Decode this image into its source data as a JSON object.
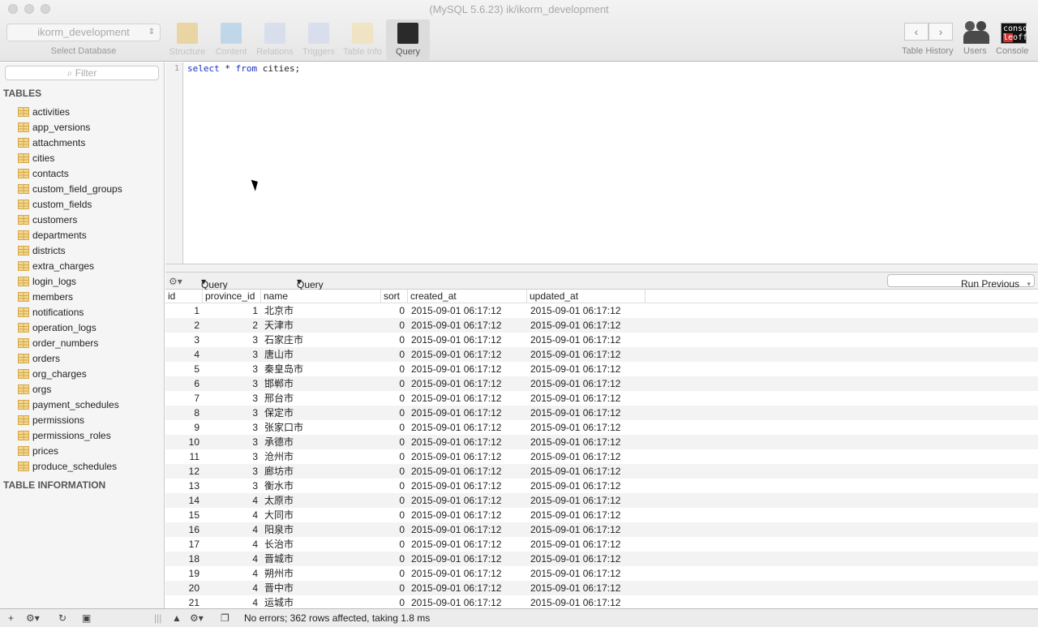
{
  "window": {
    "title": "(MySQL 5.6.23) ik/ikorm_development"
  },
  "toolbar": {
    "database": "ikorm_development",
    "select_database": "Select Database",
    "tabs": [
      {
        "label": "Structure",
        "color": "#e8c36a"
      },
      {
        "label": "Content",
        "color": "#9cc4e8"
      },
      {
        "label": "Relations",
        "color": "#c8d4ec"
      },
      {
        "label": "Triggers",
        "color": "#c8d4ec"
      },
      {
        "label": "Table Info",
        "color": "#f0dca0"
      },
      {
        "label": "Query",
        "color": "#2a2a2a"
      }
    ],
    "table_history": "Table History",
    "users": "Users",
    "console": "Console",
    "console_icon_text": "conso le off"
  },
  "sidebar": {
    "filter_placeholder": "Filter",
    "tables_heading": "TABLES",
    "table_info_heading": "TABLE INFORMATION",
    "tables": [
      "activities",
      "app_versions",
      "attachments",
      "cities",
      "contacts",
      "custom_field_groups",
      "custom_fields",
      "customers",
      "departments",
      "districts",
      "extra_charges",
      "login_logs",
      "members",
      "notifications",
      "operation_logs",
      "order_numbers",
      "orders",
      "org_charges",
      "orgs",
      "payment_schedules",
      "permissions",
      "permissions_roles",
      "prices",
      "produce_schedules"
    ]
  },
  "editor": {
    "line": "1",
    "kw1": "select",
    "star": " * ",
    "kw2": "from",
    "rest": " cities;"
  },
  "query_bar": {
    "favorites": "Query Favorites",
    "history": "Query History",
    "run_previous": "Run Previous"
  },
  "results": {
    "columns": [
      "id",
      "province_id",
      "name",
      "sort",
      "created_at",
      "updated_at"
    ],
    "rows": [
      [
        "1",
        "1",
        "北京市",
        "0",
        "2015-09-01 06:17:12",
        "2015-09-01 06:17:12"
      ],
      [
        "2",
        "2",
        "天津市",
        "0",
        "2015-09-01 06:17:12",
        "2015-09-01 06:17:12"
      ],
      [
        "3",
        "3",
        "石家庄市",
        "0",
        "2015-09-01 06:17:12",
        "2015-09-01 06:17:12"
      ],
      [
        "4",
        "3",
        "唐山市",
        "0",
        "2015-09-01 06:17:12",
        "2015-09-01 06:17:12"
      ],
      [
        "5",
        "3",
        "秦皇岛市",
        "0",
        "2015-09-01 06:17:12",
        "2015-09-01 06:17:12"
      ],
      [
        "6",
        "3",
        "邯郸市",
        "0",
        "2015-09-01 06:17:12",
        "2015-09-01 06:17:12"
      ],
      [
        "7",
        "3",
        "邢台市",
        "0",
        "2015-09-01 06:17:12",
        "2015-09-01 06:17:12"
      ],
      [
        "8",
        "3",
        "保定市",
        "0",
        "2015-09-01 06:17:12",
        "2015-09-01 06:17:12"
      ],
      [
        "9",
        "3",
        "张家口市",
        "0",
        "2015-09-01 06:17:12",
        "2015-09-01 06:17:12"
      ],
      [
        "10",
        "3",
        "承德市",
        "0",
        "2015-09-01 06:17:12",
        "2015-09-01 06:17:12"
      ],
      [
        "11",
        "3",
        "沧州市",
        "0",
        "2015-09-01 06:17:12",
        "2015-09-01 06:17:12"
      ],
      [
        "12",
        "3",
        "廊坊市",
        "0",
        "2015-09-01 06:17:12",
        "2015-09-01 06:17:12"
      ],
      [
        "13",
        "3",
        "衡水市",
        "0",
        "2015-09-01 06:17:12",
        "2015-09-01 06:17:12"
      ],
      [
        "14",
        "4",
        "太原市",
        "0",
        "2015-09-01 06:17:12",
        "2015-09-01 06:17:12"
      ],
      [
        "15",
        "4",
        "大同市",
        "0",
        "2015-09-01 06:17:12",
        "2015-09-01 06:17:12"
      ],
      [
        "16",
        "4",
        "阳泉市",
        "0",
        "2015-09-01 06:17:12",
        "2015-09-01 06:17:12"
      ],
      [
        "17",
        "4",
        "长治市",
        "0",
        "2015-09-01 06:17:12",
        "2015-09-01 06:17:12"
      ],
      [
        "18",
        "4",
        "晋城市",
        "0",
        "2015-09-01 06:17:12",
        "2015-09-01 06:17:12"
      ],
      [
        "19",
        "4",
        "朔州市",
        "0",
        "2015-09-01 06:17:12",
        "2015-09-01 06:17:12"
      ],
      [
        "20",
        "4",
        "晋中市",
        "0",
        "2015-09-01 06:17:12",
        "2015-09-01 06:17:12"
      ],
      [
        "21",
        "4",
        "运城市",
        "0",
        "2015-09-01 06:17:12",
        "2015-09-01 06:17:12"
      ]
    ]
  },
  "status": {
    "message": "No errors; 362 rows affected, taking 1.8 ms"
  }
}
